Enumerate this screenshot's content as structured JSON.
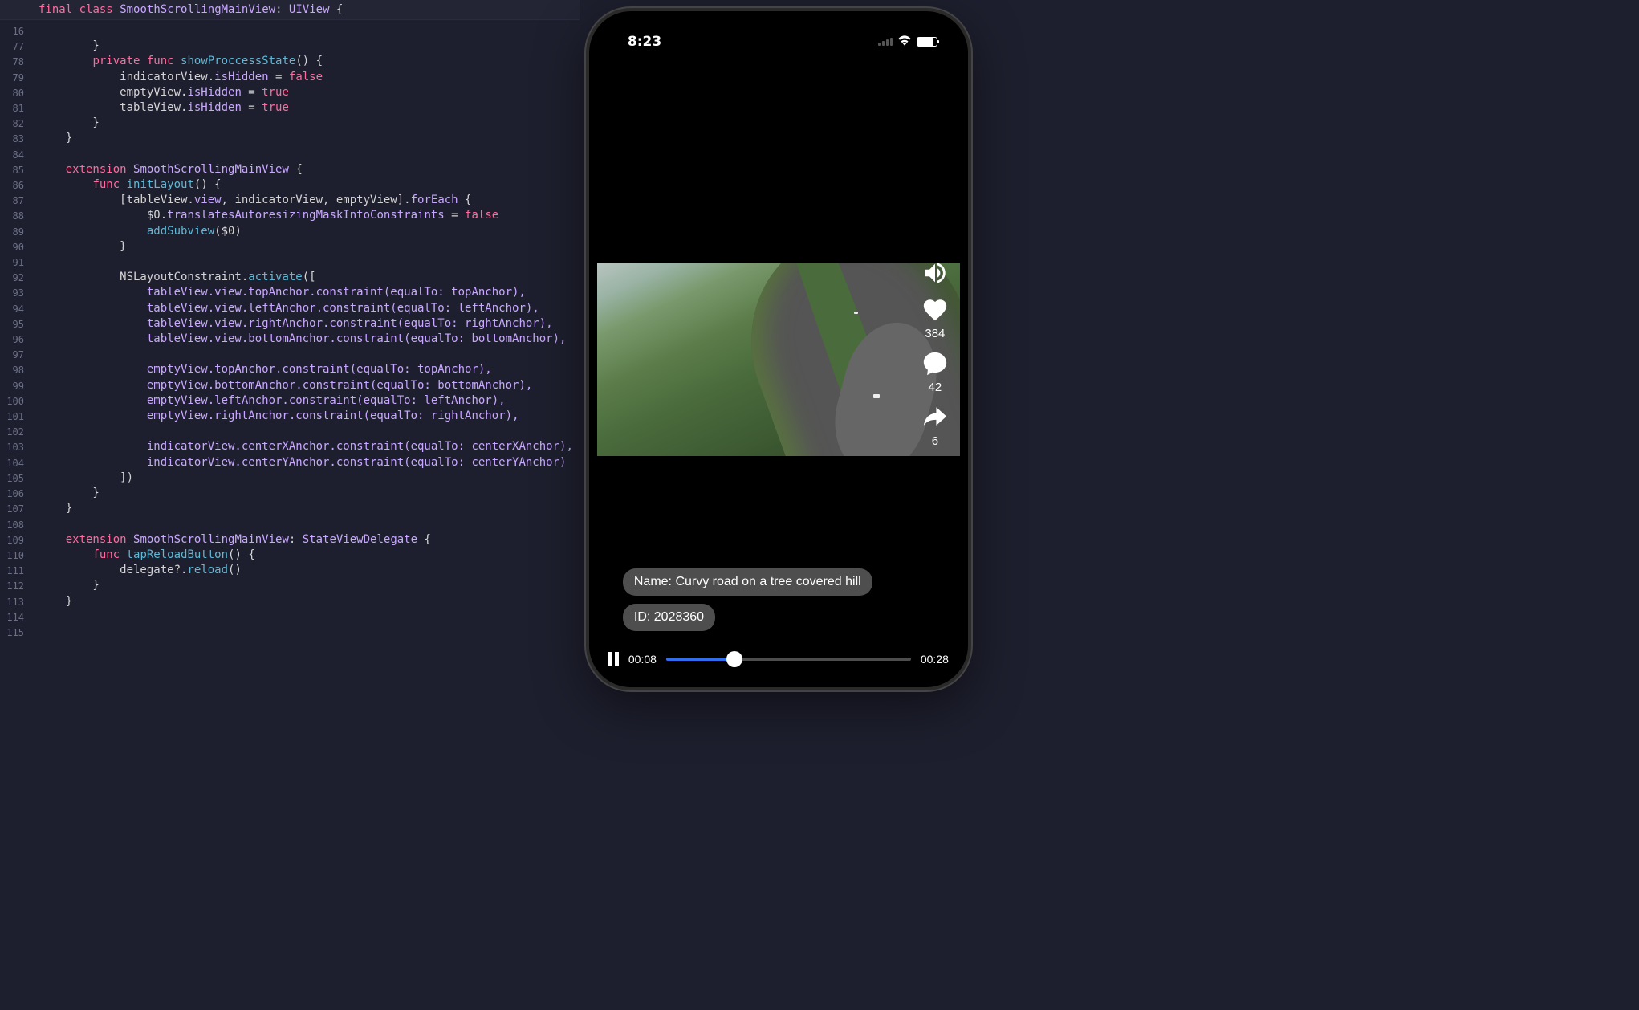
{
  "editor": {
    "class_decl": {
      "keyword1": "final",
      "keyword2": "class",
      "name": "SmoothScrollingMainView",
      "super": "UIView",
      "brace": "{"
    },
    "line_numbers": [
      "16",
      "77",
      "78",
      "79",
      "80",
      "81",
      "82",
      "83",
      "84",
      "85",
      "86",
      "87",
      "88",
      "89",
      "90",
      "91",
      "92",
      "93",
      "94",
      "95",
      "96",
      "97",
      "98",
      "99",
      "100",
      "101",
      "102",
      "103",
      "104",
      "105",
      "106",
      "107",
      "108",
      "109",
      "110",
      "111",
      "112",
      "113",
      "114",
      "115"
    ],
    "code": {
      "l77": "        }",
      "l78": "",
      "l79_kw": "private func",
      "l79_fn": "showProccessState",
      "l79_rest": "() {",
      "l80_a": "            indicatorView.",
      "l80_b": "isHidden",
      "l80_c": " = ",
      "l80_d": "false",
      "l81_a": "            emptyView.",
      "l81_b": "isHidden",
      "l81_c": " = ",
      "l81_d": "true",
      "l82_a": "            tableView.",
      "l82_b": "isHidden",
      "l82_c": " = ",
      "l82_d": "true",
      "l83": "        }",
      "l84": "    }",
      "l85": "",
      "l86_kw": "extension",
      "l86_type": "SmoothScrollingMainView",
      "l86_rest": " {",
      "l87_kw": "func",
      "l87_fn": "initLayout",
      "l87_rest": "() {",
      "l88_a": "            [tableView.",
      "l88_b": "view",
      "l88_c": ", indicatorView, emptyView].",
      "l88_d": "forEach",
      "l88_e": " {",
      "l89_a": "                $0.",
      "l89_b": "translatesAutoresizingMaskIntoConstraints",
      "l89_c": " = ",
      "l89_d": "false",
      "l90_a": "                ",
      "l90_b": "addSubview",
      "l90_c": "($0)",
      "l91": "            }",
      "l92": "",
      "l93_a": "            NSLayoutConstraint.",
      "l93_b": "activate",
      "l93_c": "([",
      "l94": "                tableView.view.topAnchor.constraint(equalTo: topAnchor),",
      "l95": "                tableView.view.leftAnchor.constraint(equalTo: leftAnchor),",
      "l96": "                tableView.view.rightAnchor.constraint(equalTo: rightAnchor),",
      "l97": "                tableView.view.bottomAnchor.constraint(equalTo: bottomAnchor),",
      "l98": "",
      "l99": "                emptyView.topAnchor.constraint(equalTo: topAnchor),",
      "l100": "                emptyView.bottomAnchor.constraint(equalTo: bottomAnchor),",
      "l101": "                emptyView.leftAnchor.constraint(equalTo: leftAnchor),",
      "l102": "                emptyView.rightAnchor.constraint(equalTo: rightAnchor),",
      "l103": "",
      "l104": "                indicatorView.centerXAnchor.constraint(equalTo: centerXAnchor),",
      "l105": "                indicatorView.centerYAnchor.constraint(equalTo: centerYAnchor)",
      "l106": "            ])",
      "l107": "        }",
      "l108": "    }",
      "l109": "",
      "l110_kw": "extension",
      "l110_type": "SmoothScrollingMainView",
      "l110_proto": "StateViewDelegate",
      "l110_rest": " {",
      "l111_kw": "func",
      "l111_fn": "tapReloadButton",
      "l111_rest": "() {",
      "l112_a": "            delegate?.",
      "l112_b": "reload",
      "l112_c": "()",
      "l113": "        }",
      "l114": "    }",
      "l115": ""
    }
  },
  "phone": {
    "status": {
      "time": "8:23"
    },
    "actions": {
      "likes": "384",
      "comments": "42",
      "shares": "6"
    },
    "info": {
      "name_label": "Name: Curvy road on a tree covered hill",
      "id_label": "ID: 2028360"
    },
    "player": {
      "current": "00:08",
      "duration": "00:28"
    }
  }
}
